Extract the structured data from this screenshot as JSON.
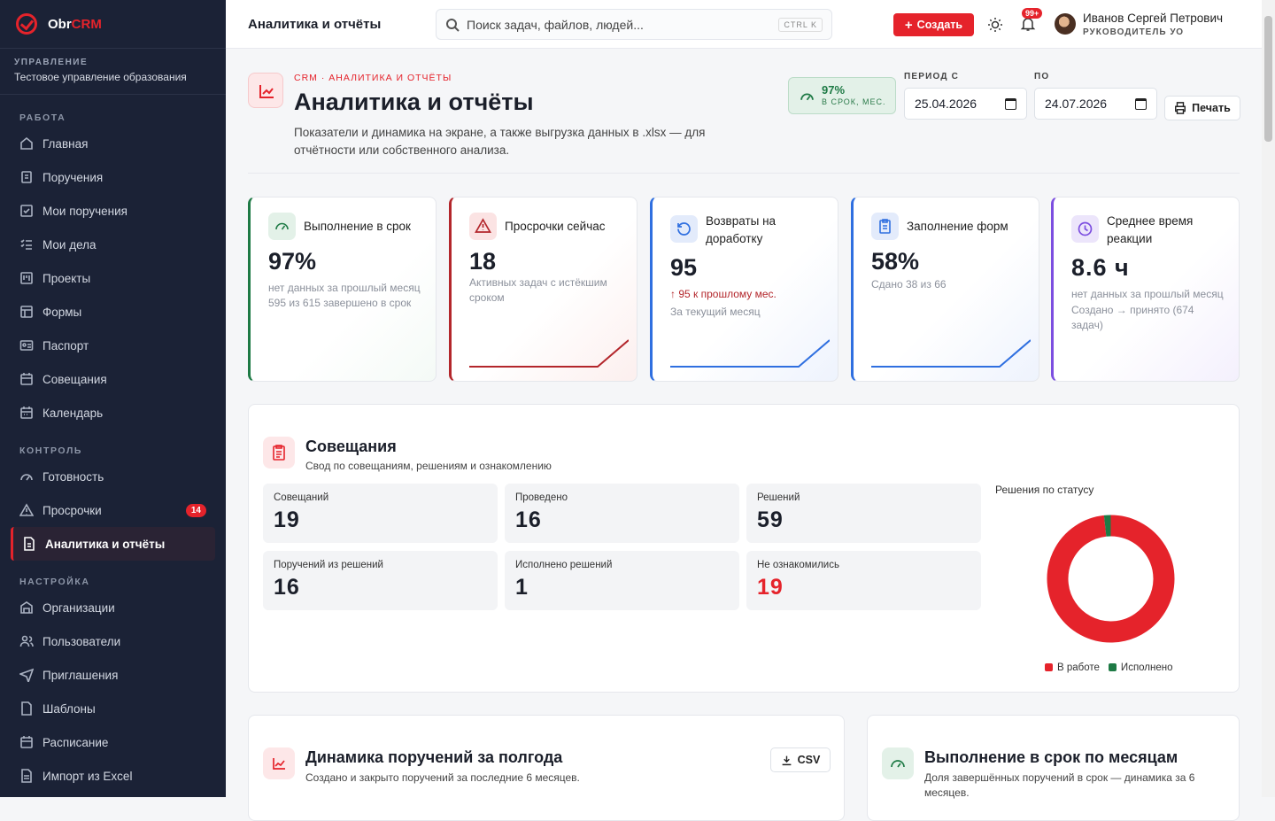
{
  "app": {
    "name_part1": "Obr",
    "name_part2": "CRM"
  },
  "org": {
    "caption": "УПРАВЛЕНИЕ",
    "name": "Тестовое управление образования"
  },
  "sidebar": {
    "sections": [
      "РАБОТА",
      "КОНТРОЛЬ",
      "НАСТРОЙКА"
    ],
    "work": [
      "Главная",
      "Поручения",
      "Мои поручения",
      "Мои дела",
      "Проекты",
      "Формы",
      "Паспорт",
      "Совещания",
      "Календарь"
    ],
    "control": [
      "Готовность",
      "Просрочки",
      "Аналитика и отчёты"
    ],
    "overdue_badge": "14",
    "settings": [
      "Организации",
      "Пользователи",
      "Приглашения",
      "Шаблоны",
      "Расписание",
      "Импорт из Excel"
    ]
  },
  "topbar": {
    "title": "Аналитика и отчёты",
    "search_placeholder": "Поиск задач, файлов, людей...",
    "shortcut": "CTRL K",
    "create": "Создать",
    "notif_badge": "99+",
    "user_name": "Иванов Сергей Петрович",
    "user_role": "РУКОВОДИТЕЛЬ УО"
  },
  "header": {
    "breadcrumb": "CRM · АНАЛИТИКА И ОТЧЁТЫ",
    "title": "Аналитика и отчёты",
    "description": "Показатели и динамика на экране, а также выгрузка данных в .xlsx — для отчётности или собственного анализа.",
    "pill_value": "97%",
    "pill_label": "В СРОК, МЕС.",
    "period_from_label": "ПЕРИОД С",
    "period_from": "25.04.2026",
    "period_to_label": "ПО",
    "period_to": "24.07.2026",
    "print": "Печать"
  },
  "kpis": [
    {
      "title": "Выполнение в срок",
      "value": "97%",
      "sub1": "нет данных за прошлый месяц",
      "sub2": "595 из 615 завершено в срок",
      "color": "#1e7a45"
    },
    {
      "title": "Просрочки сейчас",
      "value": "18",
      "sub1": "Активных задач с истёкшим сроком",
      "sub2": "",
      "color": "#b3262b"
    },
    {
      "title": "Возвраты на доработку",
      "value": "95",
      "sub1": "↑ 95 к прошлому мес.",
      "sub2": "За текущий месяц",
      "color": "#2f6fe0"
    },
    {
      "title": "Заполнение форм",
      "value": "58%",
      "sub1": "Сдано 38 из 66",
      "sub2": "",
      "color": "#2f6fe0"
    },
    {
      "title": "Среднее время реакции",
      "value": "8.6 ч",
      "sub1": "нет данных за прошлый месяц",
      "sub2": "Создано → принято (674 задач)",
      "color": "#7c4ee0"
    }
  ],
  "meetings": {
    "title": "Совещания",
    "subtitle": "Свод по совещаниям, решениям и ознакомлению",
    "stats": [
      {
        "label": "Совещаний",
        "value": "19"
      },
      {
        "label": "Проведено",
        "value": "16"
      },
      {
        "label": "Решений",
        "value": "59"
      },
      {
        "label": "Поручений из решений",
        "value": "16"
      },
      {
        "label": "Исполнено решений",
        "value": "1"
      },
      {
        "label": "Не ознакомились",
        "value": "19"
      }
    ],
    "donut_title": "Решения по статусу",
    "legend": [
      "В работе",
      "Исполнено"
    ],
    "colors": [
      "#e5232b",
      "#1e7a45"
    ]
  },
  "chart_data": {
    "type": "pie",
    "title": "Решения по статусу",
    "categories": [
      "В работе",
      "Исполнено"
    ],
    "values": [
      58,
      1
    ]
  },
  "panels": [
    {
      "title": "Динамика поручений за полгода",
      "subtitle": "Создано и закрыто поручений за последние 6 месяцев.",
      "button": "CSV"
    },
    {
      "title": "Выполнение в срок по месяцам",
      "subtitle": "Доля завершённых поручений в срок — динамика за 6 месяцев."
    }
  ]
}
